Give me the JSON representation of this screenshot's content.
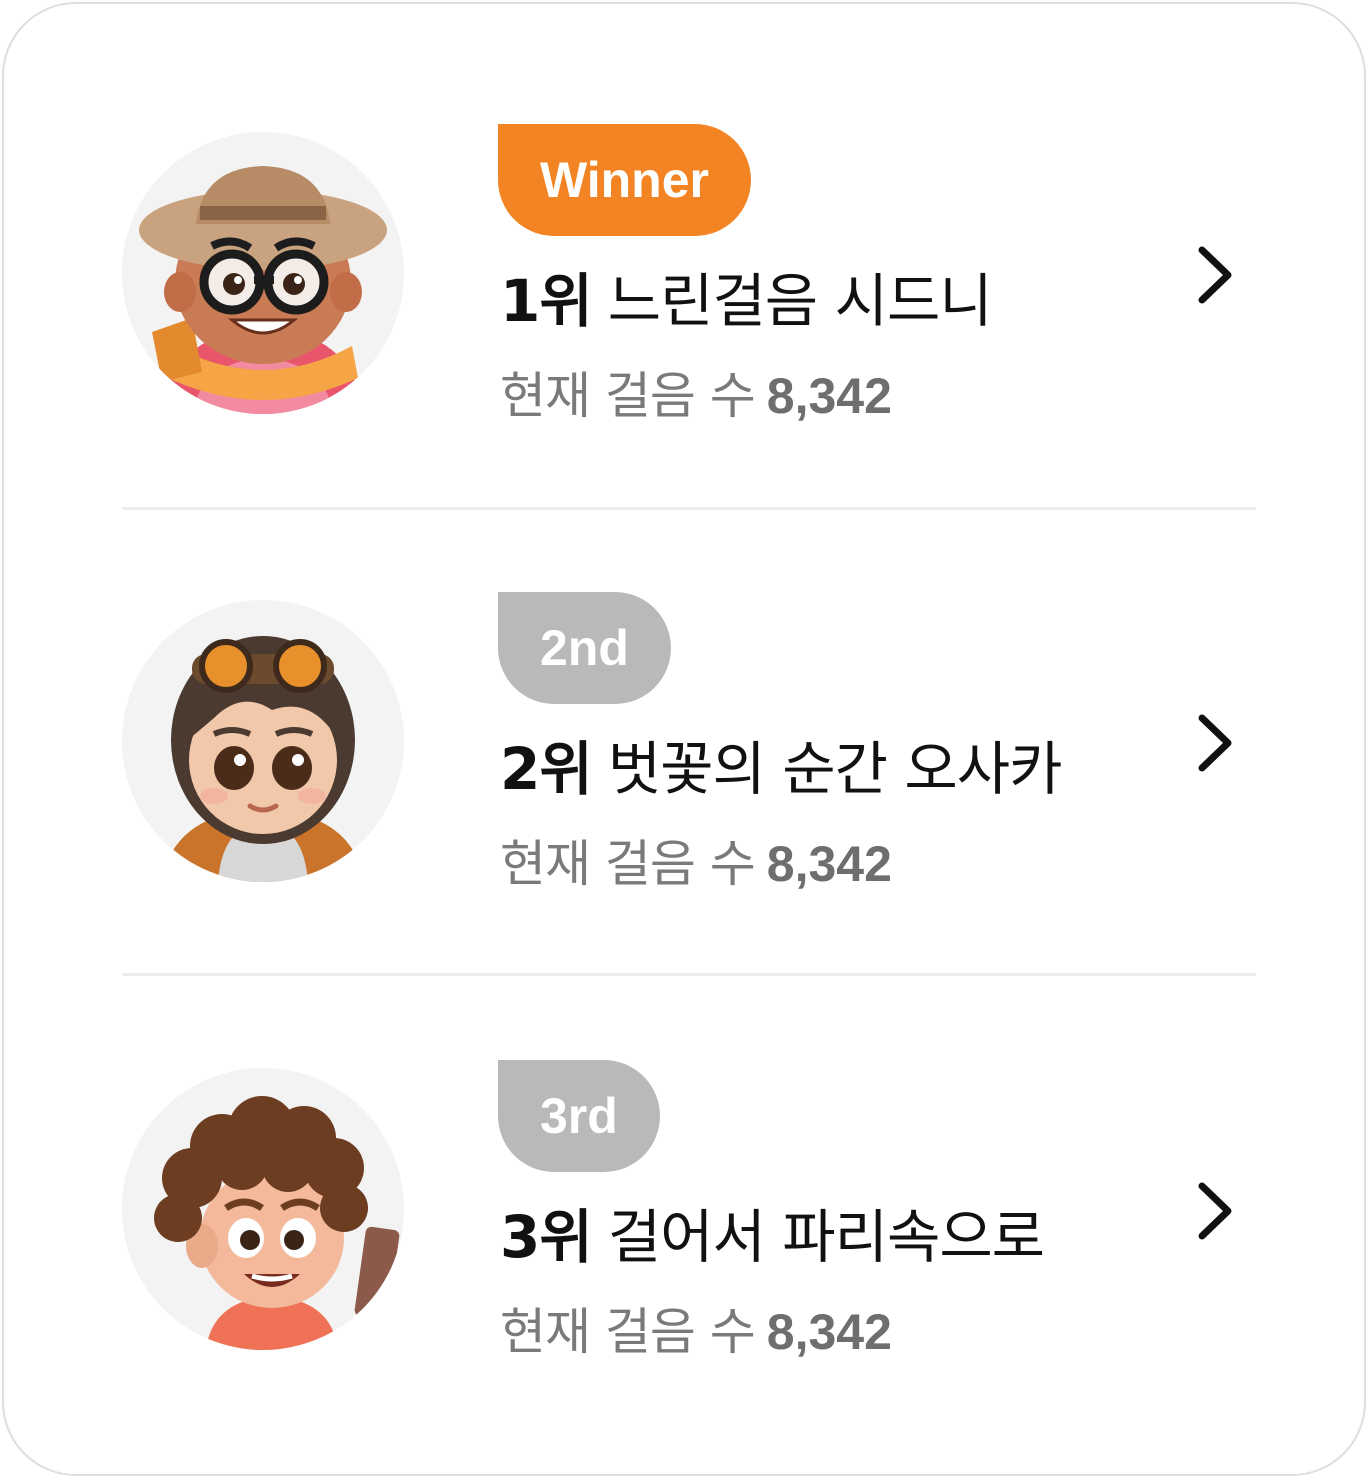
{
  "ranking": [
    {
      "badge": "Winner",
      "rank": "1위",
      "name": "느린걸음 시드니",
      "steps_label": "현재 걸음 수",
      "steps_value": "8,342",
      "badge_color": "#f38423",
      "avatar": "hat-glasses-boy-avatar"
    },
    {
      "badge": "2nd",
      "rank": "2위",
      "name": "벗꽃의 순간 오사카",
      "steps_label": "현재 걸음 수",
      "steps_value": "8,342",
      "badge_color": "#b9b9b9",
      "avatar": "goggles-girl-avatar"
    },
    {
      "badge": "3rd",
      "rank": "3위",
      "name": "걸어서 파리속으로",
      "steps_label": "현재 걸음 수",
      "steps_value": "8,342",
      "badge_color": "#b9b9b9",
      "avatar": "curly-hair-boy-avatar"
    }
  ],
  "icons": {
    "chevron": "chevron-right-icon"
  }
}
